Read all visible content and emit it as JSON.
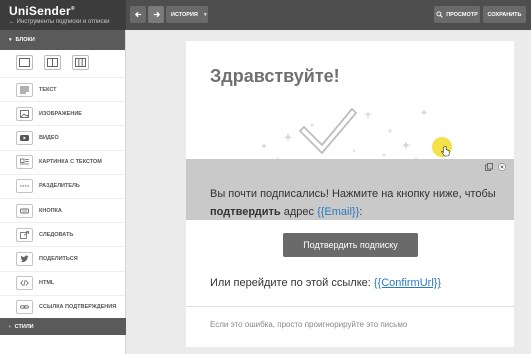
{
  "app": {
    "logo": "UniSender",
    "back_link": "Инструменты подписки и отписки"
  },
  "toolbar": {
    "history_label": "ИСТОРИЯ",
    "preview_label": "ПРОСМОТР",
    "save_label": "СОХРАНИТЬ"
  },
  "sidebar": {
    "blocks_header": "БЛОКИ",
    "styles_header": "СТИЛИ",
    "layouts": [
      "layout-1-col",
      "layout-2-col",
      "layout-3-col"
    ],
    "items": [
      {
        "label": "ТЕКСТ",
        "icon": "text-icon"
      },
      {
        "label": "ИЗОБРАЖЕНИЕ",
        "icon": "image-icon"
      },
      {
        "label": "ВИДЕО",
        "icon": "video-icon"
      },
      {
        "label": "КАРТИНКА С ТЕКСТОМ",
        "icon": "image-text-icon"
      },
      {
        "label": "РАЗДЕЛИТЕЛЬ",
        "icon": "divider-icon"
      },
      {
        "label": "КНОПКА",
        "icon": "button-icon"
      },
      {
        "label": "СЛЕДОВАТЬ",
        "icon": "follow-icon"
      },
      {
        "label": "ПОДЕЛИТЬСЯ",
        "icon": "twitter-icon"
      },
      {
        "label": "HTML",
        "icon": "code-icon"
      },
      {
        "label": "ССЫЛКА ПОДТВЕРЖДЕНИЯ",
        "icon": "link-icon"
      }
    ]
  },
  "email": {
    "greeting": "Здравствуйте!",
    "message_part1": "Вы почти подписались! Нажмите на кнопку ниже, чтобы ",
    "message_bold": "подтвердить",
    "message_part2": " адрес ",
    "email_tag": "{{Email}}",
    "message_end": ":",
    "button_label": "Подтвердить подписку",
    "alt_text": "Или перейдите по этой ссылке: ",
    "confirm_tag": "{{ConfirmUrl}}",
    "footer_note": "Если это ошибка, просто проигнорируйте это письмо"
  },
  "colors": {
    "topbar": "#4e4e4e",
    "accent_link": "#2a7ac0",
    "highlight": "#c9c9c9",
    "button": "#6a6a6a"
  }
}
